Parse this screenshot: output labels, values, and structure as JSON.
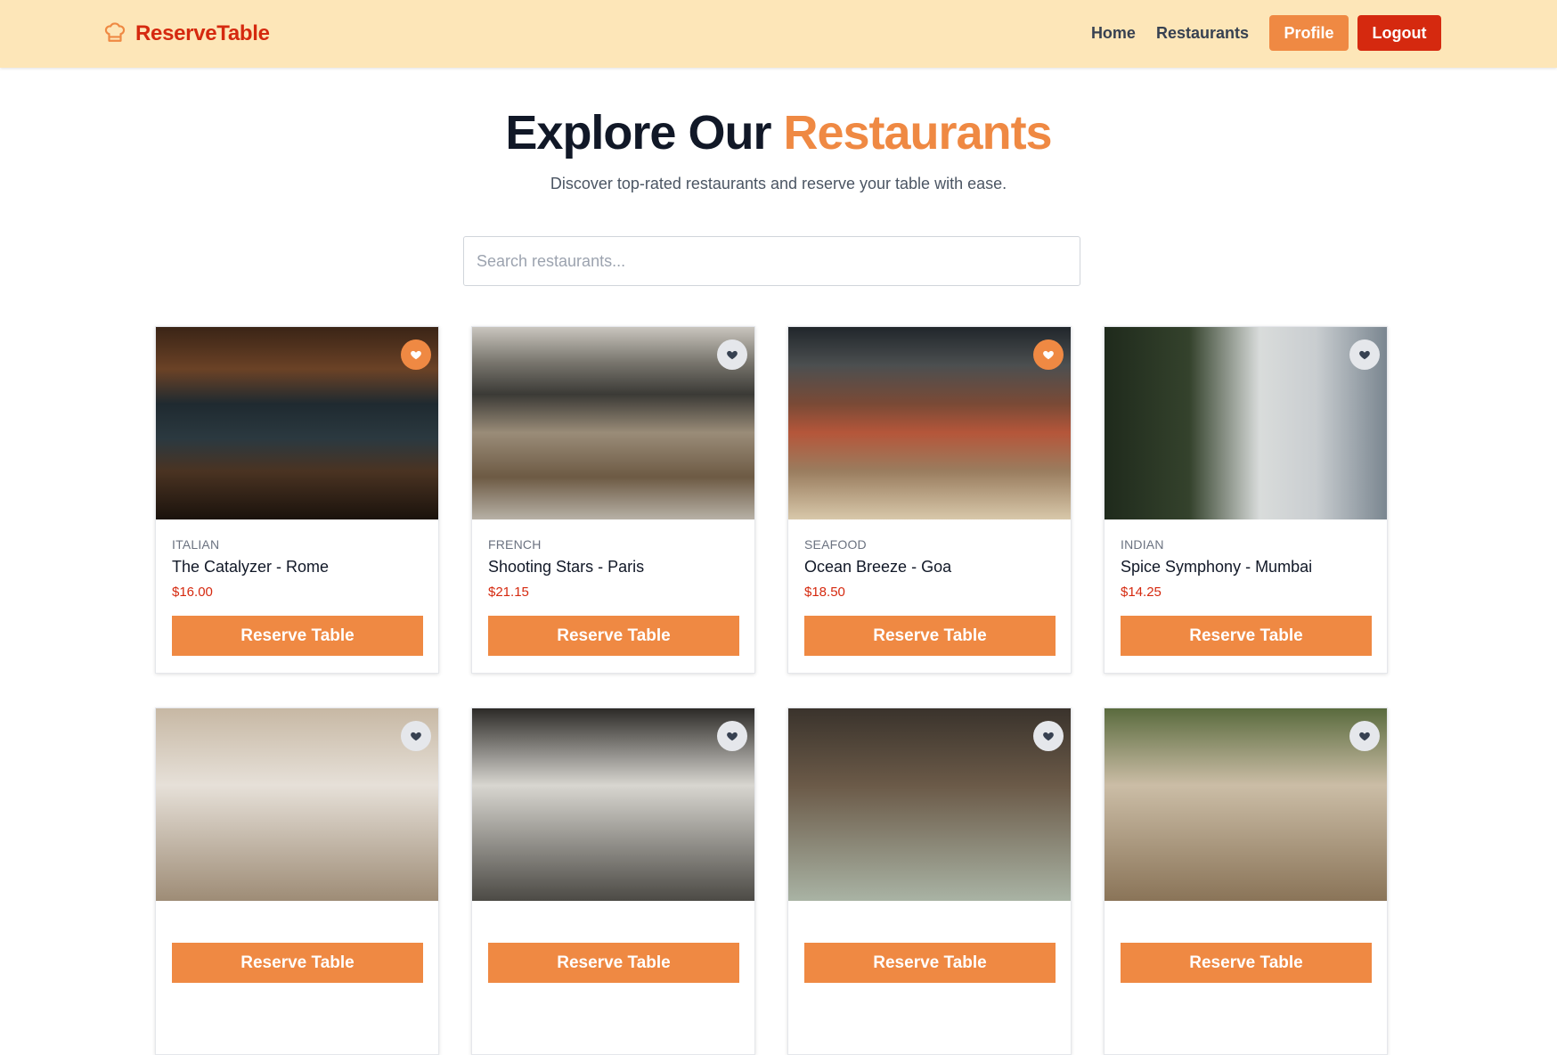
{
  "nav": {
    "brand": "ReserveTable",
    "brand_icon": "chef-hat-icon",
    "links": [
      "Home",
      "Restaurants"
    ],
    "profile_label": "Profile",
    "logout_label": "Logout"
  },
  "hero": {
    "title_main": "Explore Our ",
    "title_accent": "Restaurants",
    "subtitle": "Discover top-rated restaurants and reserve your table with ease."
  },
  "search": {
    "placeholder": "Search restaurants...",
    "value": ""
  },
  "reserve_label": "Reserve Table",
  "colors": {
    "nav_bg": "#fde6b8",
    "brand": "#d5290f",
    "accent": "#ef8943",
    "fav_inactive": "#e5e7eb"
  },
  "restaurants": [
    {
      "cuisine": "ITALIAN",
      "name": "The Catalyzer - Rome",
      "price": "$16.00",
      "favorited": true
    },
    {
      "cuisine": "FRENCH",
      "name": "Shooting Stars - Paris",
      "price": "$21.15",
      "favorited": false
    },
    {
      "cuisine": "SEAFOOD",
      "name": "Ocean Breeze - Goa",
      "price": "$18.50",
      "favorited": true
    },
    {
      "cuisine": "INDIAN",
      "name": "Spice Symphony - Mumbai",
      "price": "$14.25",
      "favorited": false
    },
    {
      "cuisine": "",
      "name": "",
      "price": "",
      "favorited": false
    },
    {
      "cuisine": "",
      "name": "",
      "price": "",
      "favorited": false
    },
    {
      "cuisine": "",
      "name": "",
      "price": "",
      "favorited": false
    },
    {
      "cuisine": "",
      "name": "",
      "price": "",
      "favorited": false
    }
  ]
}
